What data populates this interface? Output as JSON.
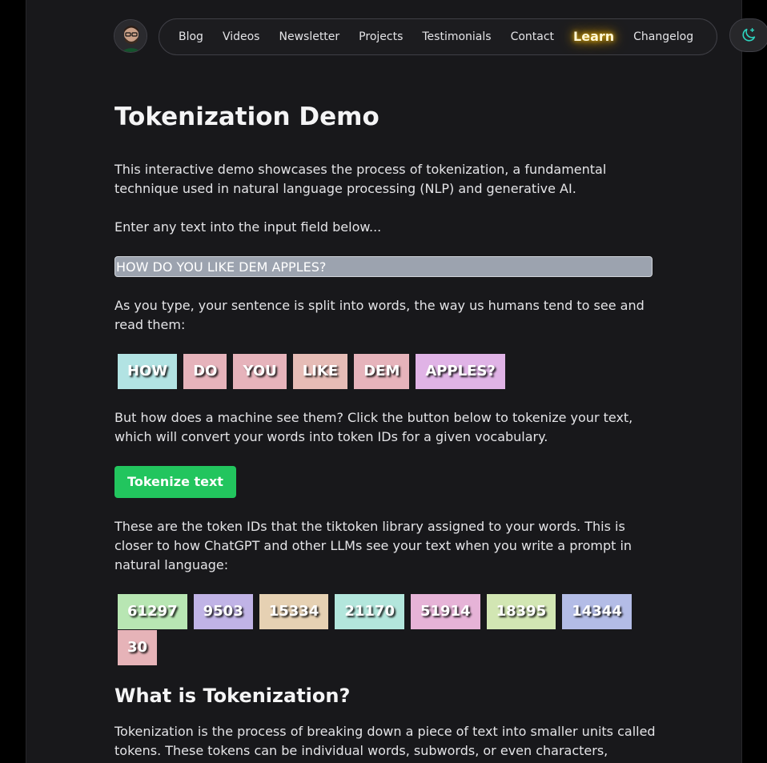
{
  "nav": {
    "items": [
      "Blog",
      "Videos",
      "Newsletter",
      "Projects",
      "Testimonials",
      "Contact",
      "Learn",
      "Changelog"
    ]
  },
  "header": {
    "avatar_icon": "user-avatar",
    "theme_icon": "moon-sparkle-icon"
  },
  "main": {
    "title": "Tokenization Demo",
    "intro": "This interactive demo showcases the process of tokenization, a fundamental technique used in natural language processing (NLP) and generative AI.",
    "enter_prompt": "Enter any text into the input field below...",
    "input_value": "HOW DO YOU LIKE DEM APPLES?",
    "split_text": "As you type, your sentence is split into words, the way us humans tend to see and read them:",
    "words": [
      "HOW",
      "DO",
      "YOU",
      "LIKE",
      "DEM",
      "APPLES?"
    ],
    "machine_text": "But how does a machine see them? Click the button below to tokenize your text, which will convert your words into token IDs for a given vocabulary.",
    "tokenize_button": "Tokenize text",
    "ids_text": "These are the token IDs that the tiktoken library assigned to your words. This is closer to how ChatGPT and other LLMs see your text when you write a prompt in natural language:",
    "token_ids": [
      "61297",
      "9503",
      "15334",
      "21170",
      "51914",
      "18395",
      "14344",
      "30"
    ],
    "section_heading": "What is Tokenization?",
    "section_text": "Tokenization is the process of breaking down a piece of text into smaller units called tokens. These tokens can be individual words, subwords, or even characters,"
  },
  "colors": {
    "page_bg": "#18181b",
    "button_green": "#22c55e",
    "word_colors": [
      "#b2e3e3",
      "#e6b3bb",
      "#e6b3bb",
      "#e6bcb6",
      "#e6b3bb",
      "#e0b3e6"
    ],
    "id_colors": [
      "#b8e6b3",
      "#c0b3e6",
      "#e6d1b3",
      "#b3e6dc",
      "#e6b3d7",
      "#d2e6b3",
      "#b3bce6",
      "#e6b3b8"
    ]
  }
}
